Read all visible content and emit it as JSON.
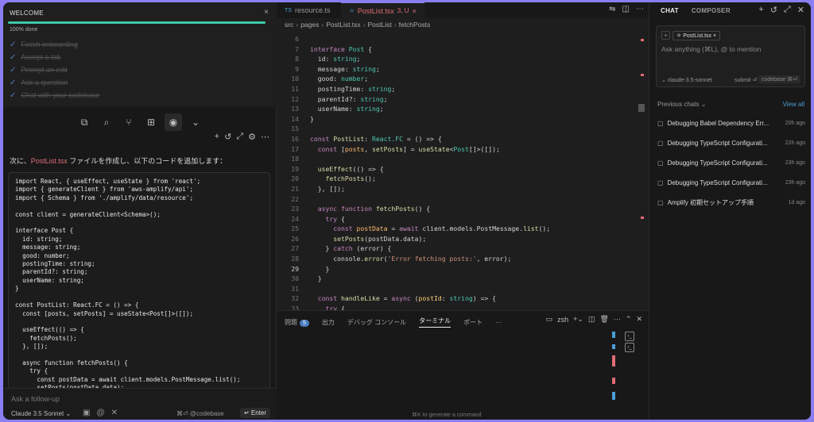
{
  "welcome": {
    "title": "WELCOME",
    "close": "×",
    "progress": 1.0,
    "progress_label": "100% done",
    "steps": [
      {
        "label": "Finish onboarding"
      },
      {
        "label": "Accept a tab"
      },
      {
        "label": "Prompt an edit"
      },
      {
        "label": "Ask a question"
      },
      {
        "label": "Chat with your codebase"
      }
    ]
  },
  "left_chat": {
    "message_prefix": "次に、",
    "message_file": "PostList.tsx",
    "message_suffix": " ファイルを作成し、以下のコードを追加します：",
    "code": "import React, { useEffect, useState } from 'react';\nimport { generateClient } from 'aws-amplify/api';\nimport { Schema } from './amplify/data/resource';\n\nconst client = generateClient<Schema>();\n\ninterface Post {\n  id: string;\n  message: string;\n  good: number;\n  postingTime: string;\n  parentId?: string;\n  userName: string;\n}\n\nconst PostList: React.FC = () => {\n  const [posts, setPosts] = useState<Post[]>([]);\n\n  useEffect(() => {\n    fetchPosts();\n  }, []);\n\n  async function fetchPosts() {\n    try {\n      const postData = await client.models.PostMessage.list();\n      setPosts(postData.data);\n    } catch (error) {",
    "followup_placeholder": "Ask a follow-up",
    "model": "Claude 3.5 Sonnet ⌄",
    "codebase_hint": "⌘⏎ @codebase",
    "enter_label": "↵ Enter"
  },
  "editor": {
    "tabs": [
      {
        "icon": "TS",
        "label": "resource.ts",
        "modified": "",
        "active": false
      },
      {
        "icon": "⚛",
        "label": "PostList.tsx",
        "modified": "3, U",
        "active": true
      }
    ],
    "breadcrumb": [
      "src",
      "pages",
      "PostList.tsx",
      "PostList",
      "fetchPosts"
    ],
    "lines": [
      {
        "n": "6",
        "html": ""
      },
      {
        "n": "7",
        "html": "<span class='k'>interface</span> <span class='t'>Post</span> {"
      },
      {
        "n": "8",
        "html": "  id: <span class='t'>string</span>;"
      },
      {
        "n": "9",
        "html": "  message: <span class='t'>string</span>;"
      },
      {
        "n": "10",
        "html": "  good: <span class='t'>number</span>;"
      },
      {
        "n": "11",
        "html": "  postingTime: <span class='t'>string</span>;"
      },
      {
        "n": "12",
        "html": "  parentId?: <span class='t'>string</span>;"
      },
      {
        "n": "13",
        "html": "  userName: <span class='t'>string</span>;"
      },
      {
        "n": "14",
        "html": "}"
      },
      {
        "n": "15",
        "html": ""
      },
      {
        "n": "16",
        "html": "<span class='k'>const</span> <span class='f'>PostList</span>: <span class='t'>React.FC</span> = () => {"
      },
      {
        "n": "17",
        "html": "  <span class='k'>const</span> [<span class='v'>posts</span>, <span class='f'>setPosts</span>] = <span class='f'>useState</span>&lt;<span class='t'>Post</span>[]&gt;([]);"
      },
      {
        "n": "18",
        "html": ""
      },
      {
        "n": "19",
        "html": "  <span class='f'>useEffect</span>(() => {"
      },
      {
        "n": "20",
        "html": "    <span class='f'>fetchPosts</span>();"
      },
      {
        "n": "21",
        "html": "  }, []);"
      },
      {
        "n": "22",
        "html": ""
      },
      {
        "n": "23",
        "html": "  <span class='k'>async function</span> <span class='f'>fetchPosts</span>() {"
      },
      {
        "n": "24",
        "html": "    <span class='k'>try</span> {"
      },
      {
        "n": "25",
        "html": "      <span class='k'>const</span> <span class='v'>postData</span> = <span class='k'>await</span> client.models.PostMessage.<span class='f'>list</span>();"
      },
      {
        "n": "26",
        "html": "      <span class='f'>setPosts</span>(postData.data);"
      },
      {
        "n": "27",
        "html": "    } <span class='k'>catch</span> (error) {"
      },
      {
        "n": "28",
        "html": "      console.<span class='f'>error</span>(<span class='s'>'Error fetching posts:'</span>, error);"
      },
      {
        "n": "29",
        "html": "    }"
      },
      {
        "n": "30",
        "html": "  }"
      },
      {
        "n": "31",
        "html": ""
      },
      {
        "n": "32",
        "html": "  <span class='k'>const</span> <span class='f'>handleLike</span> = <span class='k'>async</span> (<span class='p'>postId</span>: <span class='t'>string</span>) => {"
      },
      {
        "n": "33",
        "html": "    <span class='k'>try</span> {"
      }
    ],
    "current_line": "29",
    "panel_tabs": [
      {
        "label": "問題",
        "badge": "5",
        "active": false
      },
      {
        "label": "出力",
        "badge": "",
        "active": false
      },
      {
        "label": "デバッグ コンソール",
        "badge": "",
        "active": false
      },
      {
        "label": "ターミナル",
        "badge": "",
        "active": true
      },
      {
        "label": "ポート",
        "badge": "",
        "active": false
      },
      {
        "label": "···",
        "badge": "",
        "active": false
      }
    ],
    "shell": "zsh",
    "term_hint": "⌘K to generate a command"
  },
  "chat": {
    "tab_chat": "CHAT",
    "tab_composer": "COMPOSER",
    "file_chip": "PostList.tsx",
    "placeholder": "Ask anything (⌘L), @ to mention",
    "model": "⌄ claude-3.5-sonnet",
    "submit": "submit ⏎",
    "codebase": "codebase ⌘⏎",
    "previous_label": "Previous chats ⌄",
    "view_all": "View all",
    "history": [
      {
        "title": "Debugging Babel Dependency Err...",
        "ago": "20h ago"
      },
      {
        "title": "Debugging TypeScript Configurati...",
        "ago": "22h ago"
      },
      {
        "title": "Debugging TypeScript Configurati...",
        "ago": "23h ago"
      },
      {
        "title": "Debugging TypeScript Configurati...",
        "ago": "23h ago"
      },
      {
        "title": "Amplify 初期セットアップ手順",
        "ago": "1d ago"
      }
    ]
  },
  "colors": {
    "accent": "#8a7ef0",
    "progress": "#3ec9a7",
    "error": "#e06c75",
    "link": "#4b9fd5"
  }
}
